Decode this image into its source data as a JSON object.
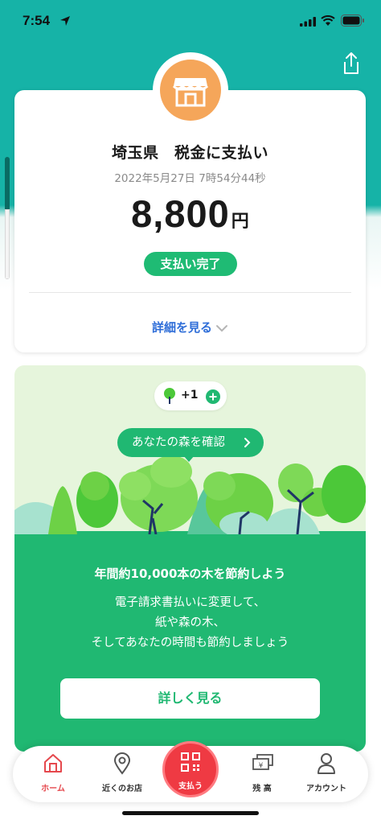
{
  "status_bar": {
    "time": "7:54"
  },
  "receipt": {
    "merchant": "埼玉県　税金に支払い",
    "datetime": "2022年5月27日 7時54分44秒",
    "amount": "8,800",
    "currency": "円",
    "status": "支払い完了",
    "details_link": "詳細を見る"
  },
  "forest": {
    "tree_count": "+1",
    "forest_link": "あなたの森を確認",
    "heading": "年間約10,000本の木を節約しよう",
    "body_lines": [
      "電子請求書払いに変更して、",
      "紙や森の木、",
      "そしてあなたの時間も節約しましょう"
    ],
    "more_button": "詳しく見る"
  },
  "tabs": [
    {
      "label": "ホーム",
      "icon": "home-icon",
      "active": true
    },
    {
      "label": "近くのお店",
      "icon": "map-pin-icon"
    },
    {
      "label": "支払う",
      "icon": "qr-code-icon"
    },
    {
      "label": "残 高",
      "icon": "money-icon"
    },
    {
      "label": "アカウント",
      "icon": "account-icon"
    }
  ],
  "colors": {
    "header_teal": "#16b3a7",
    "accent_green": "#20b872",
    "badge_green": "#1fbb74",
    "pay_red": "#ef3a43",
    "store_orange": "#f5a65a",
    "link_blue": "#2f6ed8"
  }
}
